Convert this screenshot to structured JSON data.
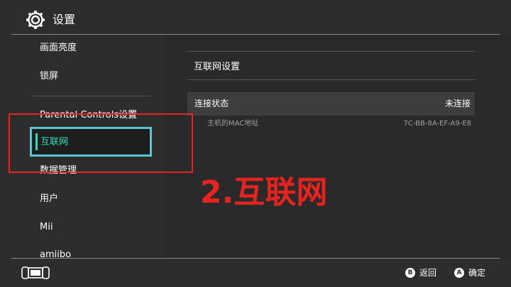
{
  "header": {
    "title": "设置",
    "icon": "gear-icon"
  },
  "sidebar": {
    "items": [
      {
        "label": "画面亮度"
      },
      {
        "label": "锁屏"
      },
      {
        "label": "Parental Controls设置"
      },
      {
        "label": "互联网",
        "selected": true
      },
      {
        "label": "数据管理"
      },
      {
        "label": "用户"
      },
      {
        "label": "Mii"
      },
      {
        "label": "amiibo"
      }
    ]
  },
  "content": {
    "section_title": "互联网设置",
    "connection_status_label": "连接状态",
    "connection_status_value": "未连接",
    "mac_label": "主机的MAC地址",
    "mac_value": "7C-BB-8A-EF-A9-E8"
  },
  "annotation": {
    "text": "2.互联网",
    "color": "#e8231f"
  },
  "footer": {
    "back_button_glyph": "B",
    "back_label": "返回",
    "confirm_button_glyph": "A",
    "confirm_label": "确定",
    "console_icon": "switch-console-icon"
  },
  "colors": {
    "background": "#2d2d2d",
    "accent": "#2fe0bc",
    "selection_border": "#58c9d4"
  }
}
